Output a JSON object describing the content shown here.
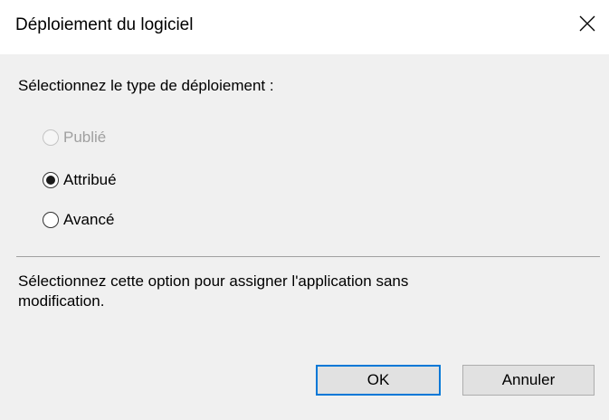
{
  "window": {
    "title": "Déploiement du logiciel",
    "close_glyph": "✕"
  },
  "prompt": "Sélectionnez le type de déploiement :",
  "options": [
    {
      "label": "Publié",
      "selected": false,
      "enabled": false
    },
    {
      "label": "Attribué",
      "selected": true,
      "enabled": true
    },
    {
      "label": "Avancé",
      "selected": false,
      "enabled": true
    }
  ],
  "description_lines": [
    "Sélectionnez cette option pour assigner l'application sans",
    "modification."
  ],
  "buttons": {
    "ok_label": "OK",
    "cancel_label": "Annuler"
  },
  "colors": {
    "accent": "#0078d7",
    "background": "#f0f0f0",
    "disabled_text": "#a0a0a0"
  }
}
